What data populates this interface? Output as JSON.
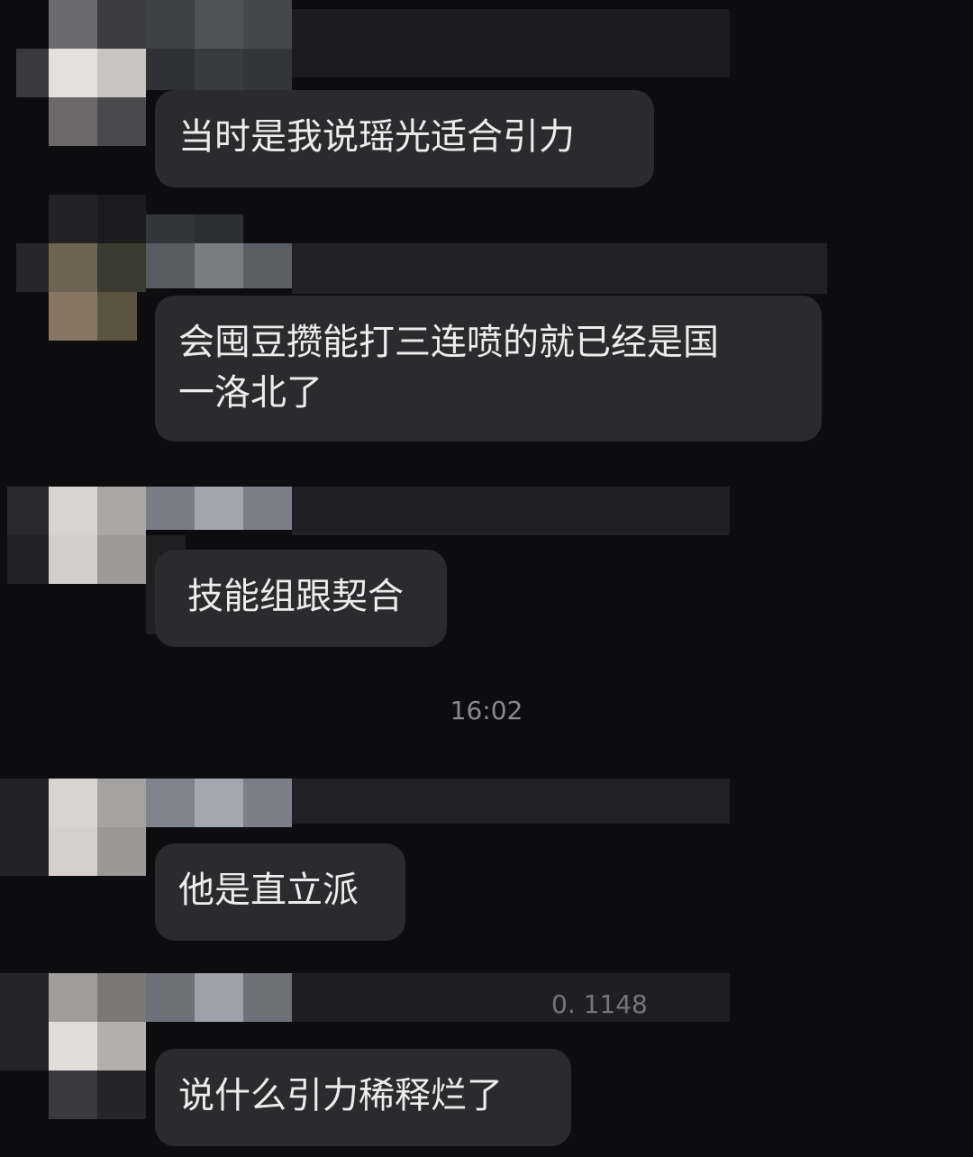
{
  "messages": [
    {
      "text": "当时是我说瑶光适合引力"
    },
    {
      "text": "会囤豆攒能打三连喷的就已经是国\n一洛北了"
    },
    {
      "text": "技能组跟契合"
    },
    {
      "text": "他是直立派"
    },
    {
      "text": "说什么引力稀释烂了"
    }
  ],
  "timestamp": "16:02",
  "partial_name_text": "0. 1148"
}
